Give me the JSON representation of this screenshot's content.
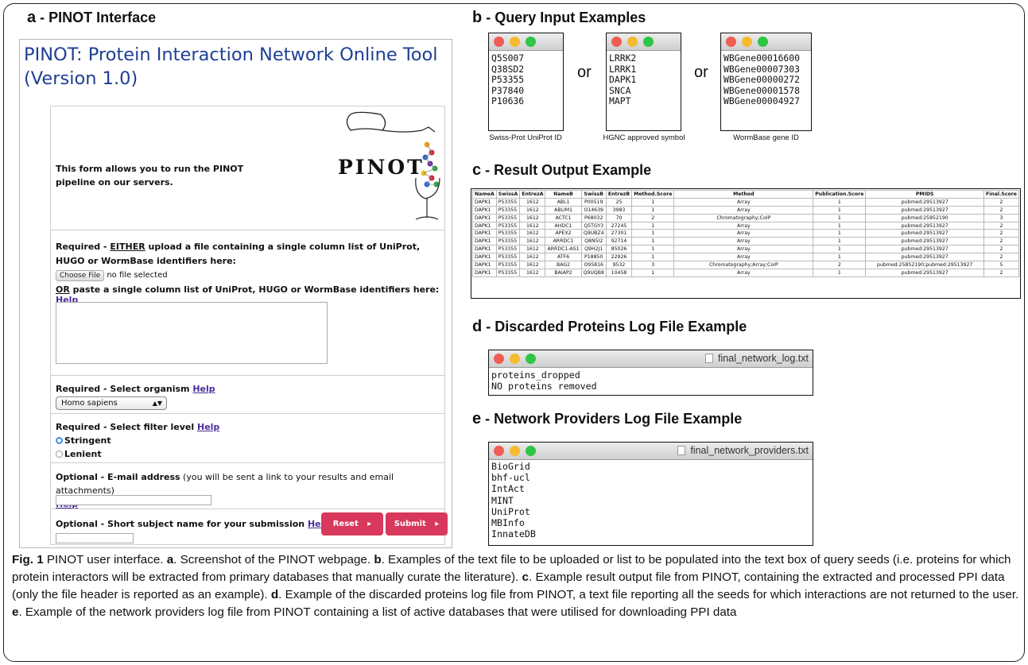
{
  "panels": {
    "a": {
      "letter": "a",
      "title": " - PINOT Interface"
    },
    "b": {
      "letter": "b",
      "title": " - Query Input Examples"
    },
    "c": {
      "letter": "c",
      "title": " - Result Output Example"
    },
    "d": {
      "letter": "d",
      "title": " - Discarded Proteins Log File Example"
    },
    "e": {
      "letter": "e",
      "title": " - Network Providers Log File Example"
    }
  },
  "pinot": {
    "title": "PINOT: Protein Interaction Network Online Tool (Version 1.0)",
    "intro": "This form allows you to run the PINOT pipeline on our servers.",
    "logo_text": "PINOT",
    "upload": {
      "required": "Required - ",
      "either": "EITHER",
      "text": " upload a file containing a single column list of UniProt, HUGO or WormBase identifiers here:",
      "choose_file": "Choose File",
      "no_file": "no file selected",
      "or": "OR",
      "paste_text": " paste a single column list of UniProt, HUGO or WormBase identifiers here: ",
      "help": "Help"
    },
    "organism": {
      "label": "Required - Select organism ",
      "help": "Help",
      "selected": "Homo sapiens"
    },
    "filter": {
      "label": "Required - Select filter level ",
      "help": "Help",
      "option1": "Stringent",
      "option2": "Lenient"
    },
    "email": {
      "label": "Optional - E-mail address",
      "note": " (you will be sent a link to your results and email attachments)",
      "help": "Help"
    },
    "subject": {
      "label": "Optional - Short subject name for your submission ",
      "help": "Help"
    },
    "reset": "Reset",
    "submit": "Submit",
    "arrow": "▸"
  },
  "query_examples": {
    "or_word": "or",
    "lists": [
      {
        "lines": "Q5S007\nQ38SD2\nP53355\nP37840\nP10636",
        "caption": "Swiss-Prot UniProt ID"
      },
      {
        "lines": "LRRK2\nLRRK1\nDAPK1\nSNCA\nMAPT",
        "caption": "HGNC approved symbol"
      },
      {
        "lines": "WBGene00016600\nWBGene00007303\nWBGene00000272\nWBGene00001578\nWBGene00004927",
        "caption": "WormBase gene ID"
      }
    ]
  },
  "result_table": {
    "headers": [
      "NameA",
      "SwissA",
      "EntrezA",
      "NameB",
      "SwissB",
      "EntrezB",
      "Method.Score",
      "Method",
      "Publication.Score",
      "PMIDS",
      "Final.Score"
    ],
    "rows": [
      [
        "DAPK1",
        "P53355",
        "1612",
        "ABL1",
        "P00519",
        "25",
        "1",
        "Array",
        "1",
        "pubmed:29513927",
        "2"
      ],
      [
        "DAPK1",
        "P53355",
        "1612",
        "ABLIM1",
        "O14639",
        "3983",
        "1",
        "Array",
        "1",
        "pubmed:29513927",
        "2"
      ],
      [
        "DAPK1",
        "P53355",
        "1612",
        "ACTC1",
        "P68032",
        "70",
        "2",
        "Chromatography;CoIP",
        "1",
        "pubmed:25852190",
        "3"
      ],
      [
        "DAPK1",
        "P53355",
        "1612",
        "AHDC1",
        "Q5TGY3",
        "27245",
        "1",
        "Array",
        "1",
        "pubmed:29513927",
        "2"
      ],
      [
        "DAPK1",
        "P53355",
        "1612",
        "APEX2",
        "Q9UBZ4",
        "27301",
        "1",
        "Array",
        "1",
        "pubmed:29513927",
        "2"
      ],
      [
        "DAPK1",
        "P53355",
        "1612",
        "ARRDC1",
        "Q8N5I2",
        "92714",
        "1",
        "Array",
        "1",
        "pubmed:29513927",
        "2"
      ],
      [
        "DAPK1",
        "P53355",
        "1612",
        "ARRDC1-AS1",
        "Q9H2J1",
        "85026",
        "1",
        "Array",
        "1",
        "pubmed:29513927",
        "2"
      ],
      [
        "DAPK1",
        "P53355",
        "1612",
        "ATF6",
        "P18850",
        "22926",
        "1",
        "Array",
        "1",
        "pubmed:29513927",
        "2"
      ],
      [
        "DAPK1",
        "P53355",
        "1612",
        "BAG2",
        "O95816",
        "9532",
        "3",
        "Chromatography;Array;CoIP",
        "2",
        "pubmed:25852190;pubmed:29513927",
        "5"
      ],
      [
        "DAPK1",
        "P53355",
        "1612",
        "BAIAP2",
        "Q9UQB8",
        "10458",
        "1",
        "Array",
        "1",
        "pubmed:29513927",
        "2"
      ]
    ]
  },
  "discarded_log": {
    "file_name": "final_network_log.txt",
    "lines": "proteins_dropped\nNO proteins removed"
  },
  "providers_log": {
    "file_name": "final_network_providers.txt",
    "lines": "BioGrid\nbhf-ucl\nIntAct\nMINT\nUniProt\nMBInfo\nInnateDB"
  },
  "caption": {
    "fig": "Fig. 1",
    "intro": " PINOT user interface. ",
    "a_label": "a",
    "a_text": ". Screenshot of the PINOT webpage. ",
    "b_label": "b",
    "b_text": ". Examples of the text file to be uploaded or list to be populated into the text box of query seeds (i.e. proteins for which protein interactors will be extracted from primary databases that manually curate the literature). ",
    "c_label": "c",
    "c_text": ". Example result output file from PINOT, containing the extracted and processed PPI data (only the file header is reported as an example). ",
    "d_label": "d",
    "d_text": ". Example of the discarded proteins log file from PINOT, a text file reporting all the seeds for which interactions are not returned to the user. ",
    "e_label": "e",
    "e_text": ". Example of the network providers log file from PINOT containing a list of active databases that were utilised for downloading PPI data"
  }
}
